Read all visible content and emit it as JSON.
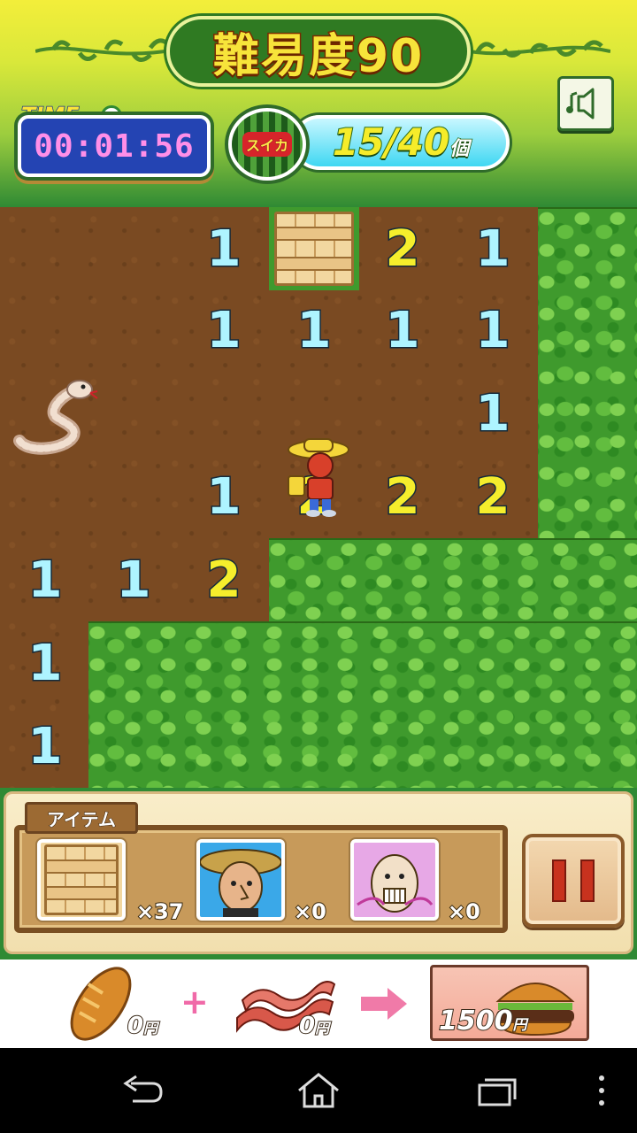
{
  "header": {
    "title": "難易度90",
    "time_label": "TIME",
    "time_value": "00:01:56",
    "melon_label": "スイカ",
    "melon_count": "15/40",
    "melon_unit": "個"
  },
  "board": {
    "numbers": [
      {
        "value": "1",
        "row": 0,
        "col": 2
      },
      {
        "value": "2",
        "row": 0,
        "col": 4
      },
      {
        "value": "1",
        "row": 0,
        "col": 5
      },
      {
        "value": "1",
        "row": 1,
        "col": 2
      },
      {
        "value": "1",
        "row": 1,
        "col": 3
      },
      {
        "value": "1",
        "row": 1,
        "col": 4
      },
      {
        "value": "1",
        "row": 1,
        "col": 5
      },
      {
        "value": "1",
        "row": 2,
        "col": 5
      },
      {
        "value": "1",
        "row": 3,
        "col": 2
      },
      {
        "value": "2",
        "row": 3,
        "col": 3
      },
      {
        "value": "2",
        "row": 3,
        "col": 4
      },
      {
        "value": "2",
        "row": 3,
        "col": 5
      },
      {
        "value": "1",
        "row": 4,
        "col": 0
      },
      {
        "value": "1",
        "row": 4,
        "col": 1
      },
      {
        "value": "2",
        "row": 4,
        "col": 2
      },
      {
        "value": "1",
        "row": 5,
        "col": 0
      },
      {
        "value": "1",
        "row": 6,
        "col": 0
      }
    ]
  },
  "items": {
    "label": "アイテム",
    "slots": [
      {
        "name": "crate",
        "count": "×37"
      },
      {
        "name": "farmer",
        "count": "×0"
      },
      {
        "name": "bald-man",
        "count": "×0"
      }
    ]
  },
  "ad": {
    "bread_price": "0",
    "bacon_price": "0",
    "burger_price": "1500",
    "yen": "円",
    "plus": "+"
  },
  "colors": {
    "number_one": "#aef4ff",
    "number_two": "#f5ee2c",
    "dirt": "#7a4a22",
    "grass": "#3f9a2d"
  }
}
